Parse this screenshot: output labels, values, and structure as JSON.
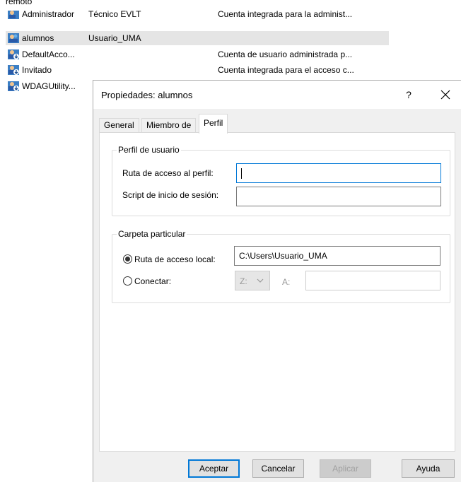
{
  "list": {
    "header": "remoto",
    "users": [
      {
        "name": "Administrador",
        "full_name": "Técnico EVLT",
        "description": "Cuenta integrada para la administ..."
      },
      {
        "name": "alumnos",
        "full_name": "Usuario_UMA",
        "description": ""
      },
      {
        "name": "DefaultAcco...",
        "full_name": "",
        "description": "Cuenta de usuario administrada p..."
      },
      {
        "name": "Invitado",
        "full_name": "",
        "description": "Cuenta integrada para el acceso c..."
      },
      {
        "name": "WDAGUtility...",
        "full_name": "",
        "description": ""
      }
    ]
  },
  "dialog": {
    "title": "Propiedades: alumnos",
    "help": "?",
    "tabs": [
      "General",
      "Miembro de",
      "Perfil"
    ],
    "active_tab": "Perfil",
    "profile_group": {
      "legend": "Perfil de usuario",
      "path_label": "Ruta de acceso al perfil:",
      "path_value": "",
      "script_label": "Script de inicio de sesión:",
      "script_value": ""
    },
    "home_group": {
      "legend": "Carpeta particular",
      "local_label": "Ruta de acceso local:",
      "local_value": "C:\\Users\\Usuario_UMA",
      "local_selected": true,
      "connect_label": "Conectar:",
      "drive_value": "Z:",
      "to_label": "A:",
      "to_value": ""
    },
    "buttons": {
      "ok": "Aceptar",
      "cancel": "Cancelar",
      "apply": "Aplicar",
      "help": "Ayuda"
    }
  },
  "colors": {
    "accent": "#0078d7",
    "selected_row": "#e5e5e5",
    "dialog_bg": "#f0f0f0"
  }
}
